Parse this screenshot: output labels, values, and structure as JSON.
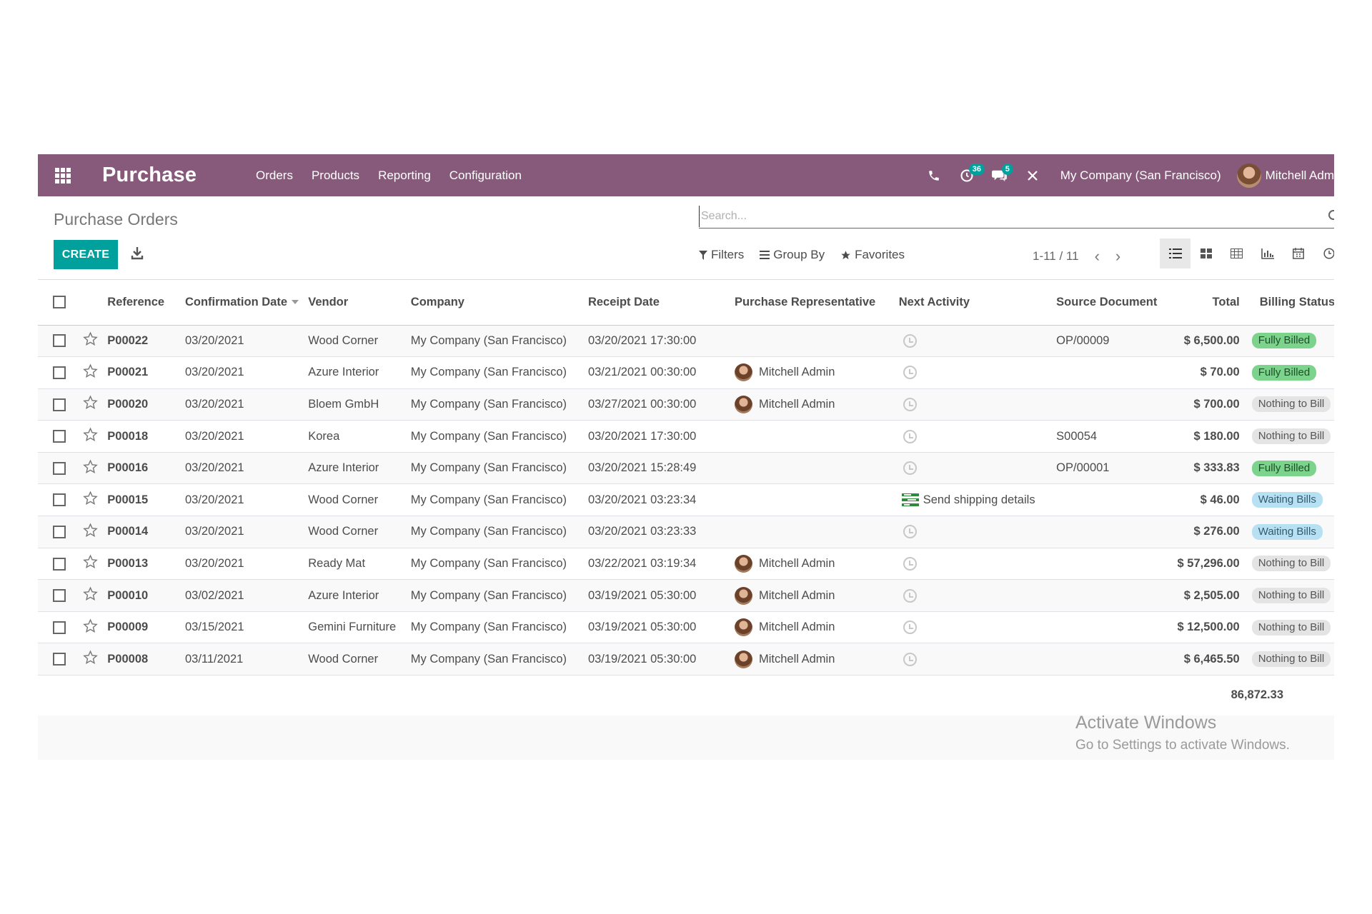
{
  "navbar": {
    "brand": "Purchase",
    "menu": [
      "Orders",
      "Products",
      "Reporting",
      "Configuration"
    ],
    "activity_count": "36",
    "message_count": "5",
    "company": "My Company (San Francisco)",
    "user": "Mitchell Adm",
    "color": "#875a7b"
  },
  "control_panel": {
    "breadcrumb": "Purchase Orders",
    "search_placeholder": "Search...",
    "create_label": "CREATE",
    "filters_label": "Filters",
    "groupby_label": "Group By",
    "favorites_label": "Favorites",
    "pager": "1-11 / 11",
    "accent": "#00a09d"
  },
  "table": {
    "columns": [
      "Reference",
      "Confirmation Date",
      "Vendor",
      "Company",
      "Receipt Date",
      "Purchase Representative",
      "Next Activity",
      "Source Document",
      "Total",
      "Billing Status"
    ],
    "rows": [
      {
        "ref": "P00022",
        "conf": "03/20/2021",
        "vendor": "Wood Corner",
        "company": "My Company (San Francisco)",
        "receipt": "03/20/2021 17:30:00",
        "rep": "",
        "activity": "",
        "source": "OP/00009",
        "total": "$ 6,500.00",
        "status": "Fully Billed",
        "status_type": "billed"
      },
      {
        "ref": "P00021",
        "conf": "03/20/2021",
        "vendor": "Azure Interior",
        "company": "My Company (San Francisco)",
        "receipt": "03/21/2021 00:30:00",
        "rep": "Mitchell Admin",
        "activity": "",
        "source": "",
        "total": "$ 70.00",
        "status": "Fully Billed",
        "status_type": "billed"
      },
      {
        "ref": "P00020",
        "conf": "03/20/2021",
        "vendor": "Bloem GmbH",
        "company": "My Company (San Francisco)",
        "receipt": "03/27/2021 00:30:00",
        "rep": "Mitchell Admin",
        "activity": "",
        "source": "",
        "total": "$ 700.00",
        "status": "Nothing to Bill",
        "status_type": "nothing"
      },
      {
        "ref": "P00018",
        "conf": "03/20/2021",
        "vendor": "Korea",
        "company": "My Company (San Francisco)",
        "receipt": "03/20/2021 17:30:00",
        "rep": "",
        "activity": "",
        "source": "S00054",
        "total": "$ 180.00",
        "status": "Nothing to Bill",
        "status_type": "nothing"
      },
      {
        "ref": "P00016",
        "conf": "03/20/2021",
        "vendor": "Azure Interior",
        "company": "My Company (San Francisco)",
        "receipt": "03/20/2021 15:28:49",
        "rep": "",
        "activity": "",
        "source": "OP/00001",
        "total": "$ 333.83",
        "status": "Fully Billed",
        "status_type": "billed"
      },
      {
        "ref": "P00015",
        "conf": "03/20/2021",
        "vendor": "Wood Corner",
        "company": "My Company (San Francisco)",
        "receipt": "03/20/2021 03:23:34",
        "rep": "",
        "activity": "Send shipping details",
        "source": "",
        "total": "$ 46.00",
        "status": "Waiting Bills",
        "status_type": "waiting"
      },
      {
        "ref": "P00014",
        "conf": "03/20/2021",
        "vendor": "Wood Corner",
        "company": "My Company (San Francisco)",
        "receipt": "03/20/2021 03:23:33",
        "rep": "",
        "activity": "",
        "source": "",
        "total": "$ 276.00",
        "status": "Waiting Bills",
        "status_type": "waiting"
      },
      {
        "ref": "P00013",
        "conf": "03/20/2021",
        "vendor": "Ready Mat",
        "company": "My Company (San Francisco)",
        "receipt": "03/22/2021 03:19:34",
        "rep": "Mitchell Admin",
        "activity": "",
        "source": "",
        "total": "$ 57,296.00",
        "status": "Nothing to Bill",
        "status_type": "nothing"
      },
      {
        "ref": "P00010",
        "conf": "03/02/2021",
        "vendor": "Azure Interior",
        "company": "My Company (San Francisco)",
        "receipt": "03/19/2021 05:30:00",
        "rep": "Mitchell Admin",
        "activity": "",
        "source": "",
        "total": "$ 2,505.00",
        "status": "Nothing to Bill",
        "status_type": "nothing"
      },
      {
        "ref": "P00009",
        "conf": "03/15/2021",
        "vendor": "Gemini Furniture",
        "company": "My Company (San Francisco)",
        "receipt": "03/19/2021 05:30:00",
        "rep": "Mitchell Admin",
        "activity": "",
        "source": "",
        "total": "$ 12,500.00",
        "status": "Nothing to Bill",
        "status_type": "nothing"
      },
      {
        "ref": "P00008",
        "conf": "03/11/2021",
        "vendor": "Wood Corner",
        "company": "My Company (San Francisco)",
        "receipt": "03/19/2021 05:30:00",
        "rep": "Mitchell Admin",
        "activity": "",
        "source": "",
        "total": "$ 6,465.50",
        "status": "Nothing to Bill",
        "status_type": "nothing"
      }
    ],
    "sum_total": "86,872.33"
  },
  "watermark": {
    "line1": "Activate Windows",
    "line2": "Go to Settings to activate Windows."
  }
}
